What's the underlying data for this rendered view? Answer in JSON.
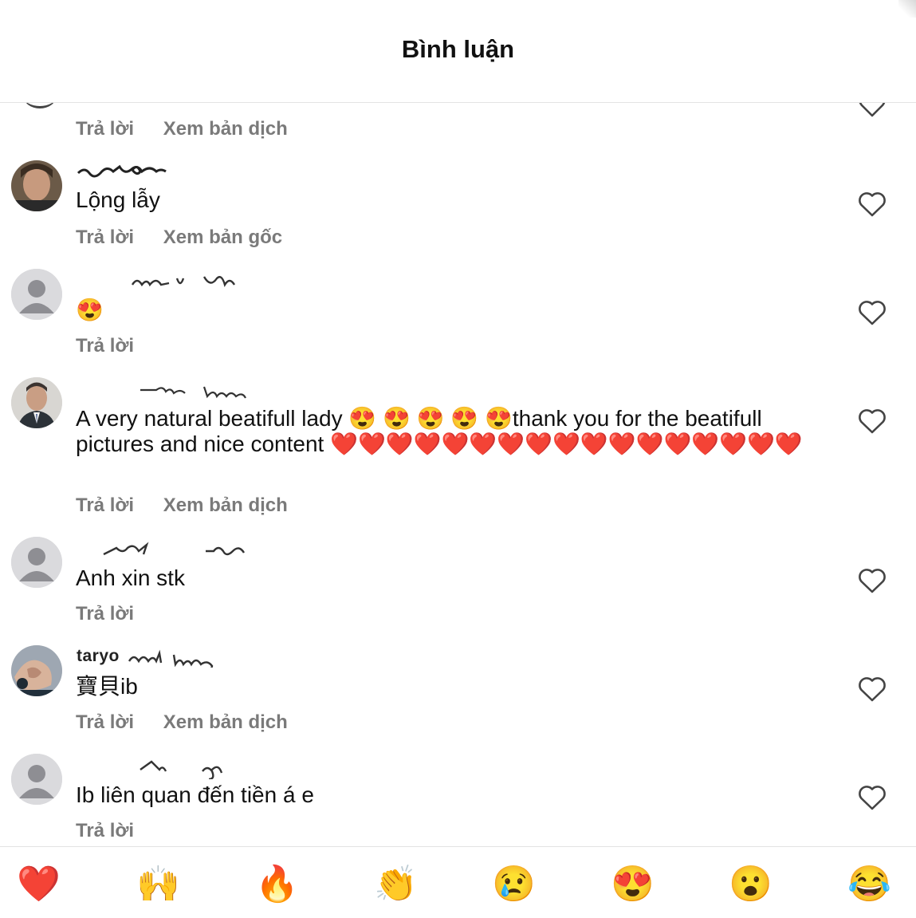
{
  "header": {
    "title": "Bình luận"
  },
  "actions": {
    "reply": "Trả lời",
    "see_translation": "Xem bản dịch",
    "see_original": "Xem bản gốc"
  },
  "comments": [
    {
      "username": "",
      "text": "",
      "actions": [
        "Trả lời",
        "Xem bản dịch"
      ]
    },
    {
      "username": "",
      "text": "Lộng lẫy",
      "actions": [
        "Trả lời",
        "Xem bản gốc"
      ]
    },
    {
      "username": "",
      "text": "😍",
      "actions": [
        "Trả lời"
      ]
    },
    {
      "username": "",
      "text": "A very natural beatifull lady 😍 😍 😍 😍 😍thank you for the beatifull pictures and nice content ❤️❤️❤️❤️❤️❤️❤️❤️❤️❤️❤️❤️❤️❤️❤️❤️❤️",
      "actions": [
        "Trả lời",
        "Xem bản dịch"
      ]
    },
    {
      "username": "",
      "text": "Anh xin stk",
      "actions": [
        "Trả lời"
      ]
    },
    {
      "username": "taryo",
      "text": "寶貝ib",
      "actions": [
        "Trả lời",
        "Xem bản dịch"
      ]
    },
    {
      "username": "",
      "text": "Ib liên quan đến tiền á e",
      "actions": [
        "Trả lời"
      ]
    }
  ],
  "reactions": [
    {
      "icon": "red-heart-icon",
      "glyph": "❤️"
    },
    {
      "icon": "raising-hands-icon",
      "glyph": "🙌"
    },
    {
      "icon": "fire-icon",
      "glyph": "🔥"
    },
    {
      "icon": "clapping-hands-icon",
      "glyph": "👏"
    },
    {
      "icon": "crying-face-icon",
      "glyph": "😢"
    },
    {
      "icon": "heart-eyes-icon",
      "glyph": "😍"
    },
    {
      "icon": "surprised-face-icon",
      "glyph": "😮"
    },
    {
      "icon": "tears-of-joy-icon",
      "glyph": "😂"
    }
  ]
}
